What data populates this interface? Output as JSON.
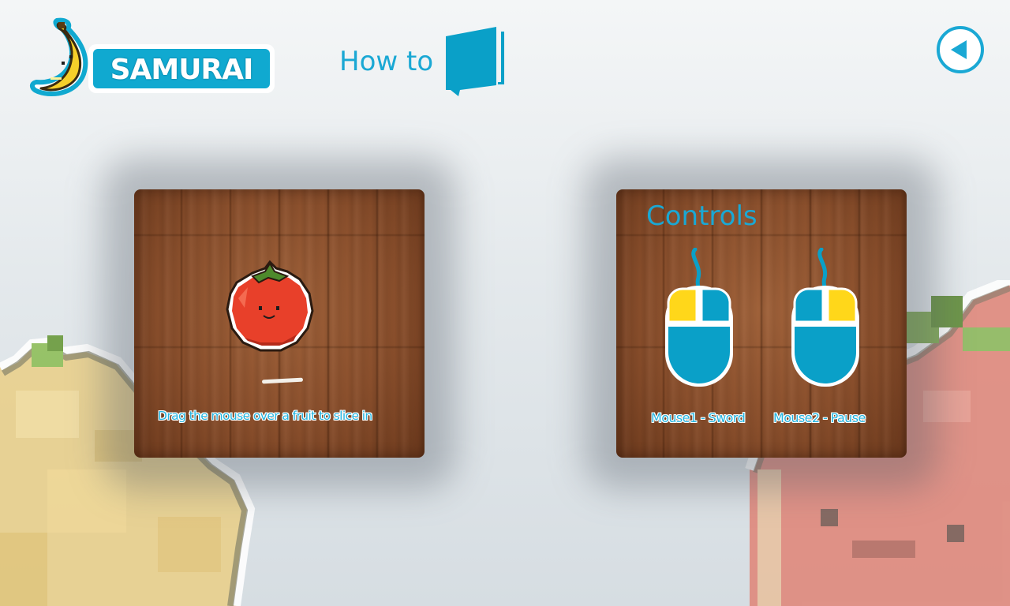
{
  "header": {
    "logo_word": "SAMURAI",
    "title": "How to",
    "back_icon": "back-arrow-icon",
    "book_icon": "book-icon"
  },
  "left_panel": {
    "illustration": "tomato-fruit",
    "caption": "Drag the mouse over a fruit to slice in"
  },
  "right_panel": {
    "title": "Controls",
    "controls": [
      {
        "label": "Mouse1 - Sword",
        "icon": "mouse-left-click-icon",
        "highlight": "left"
      },
      {
        "label": "Mouse2 - Pause",
        "icon": "mouse-right-click-icon",
        "highlight": "right"
      }
    ]
  },
  "colors": {
    "accent": "#1aa8d4",
    "mouse_body": "#0aa0c8",
    "mouse_button_highlight": "#ffd71a",
    "wood": "#8a4f2c"
  }
}
